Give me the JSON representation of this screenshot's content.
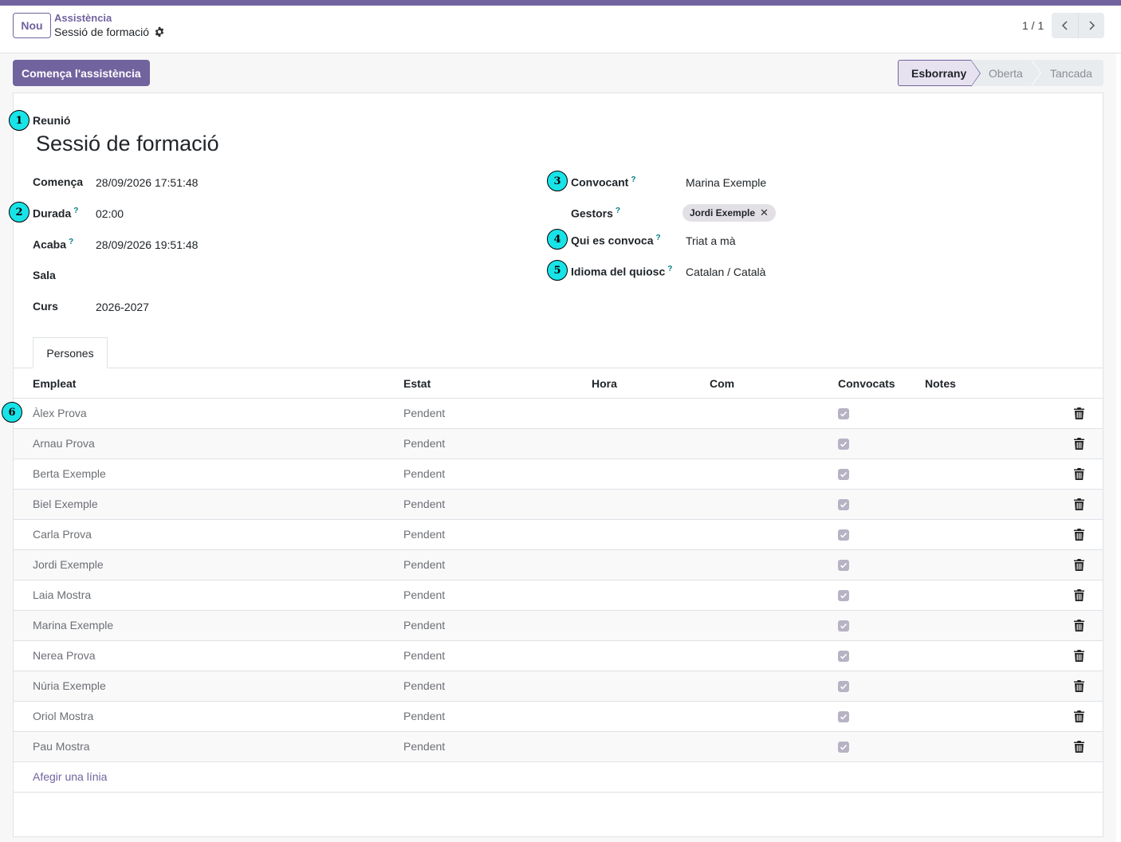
{
  "breadcrumb": {
    "parent": "Assistència",
    "current": "Sessió de formació"
  },
  "new_button": "Nou",
  "pager": {
    "value": "1 / 1"
  },
  "action_button": "Comença l'assistència",
  "statusbar": [
    {
      "label": "Esborrany",
      "active": true
    },
    {
      "label": "Oberta",
      "active": false
    },
    {
      "label": "Tancada",
      "active": false
    }
  ],
  "form": {
    "title_label": "Reunió",
    "title": "Sessió de formació",
    "left": {
      "start_label": "Comença",
      "start_value": "28/09/2026 17:51:48",
      "duration_label": "Durada",
      "duration_value": "02:00",
      "end_label": "Acaba",
      "end_value": "28/09/2026 19:51:48",
      "room_label": "Sala",
      "room_value": "",
      "course_label": "Curs",
      "course_value": "2026-2027"
    },
    "right": {
      "convener_label": "Convocant",
      "convener_value": "Marina Exemple",
      "managers_label": "Gestors",
      "managers_tag": "Jordi Exemple",
      "who_label": "Qui es convoca",
      "who_value": "Triat a mà",
      "lang_label": "Idioma del quiosc",
      "lang_value": "Catalan / Català"
    },
    "help_mark": "?"
  },
  "tab": "Persones",
  "table": {
    "headers": [
      "Empleat",
      "Estat",
      "Hora",
      "Com",
      "Convocats",
      "Notes"
    ],
    "rows": [
      {
        "name": "Àlex Prova",
        "status": "Pendent"
      },
      {
        "name": "Arnau Prova",
        "status": "Pendent"
      },
      {
        "name": "Berta Exemple",
        "status": "Pendent"
      },
      {
        "name": "Biel Exemple",
        "status": "Pendent"
      },
      {
        "name": "Carla Prova",
        "status": "Pendent"
      },
      {
        "name": "Jordi Exemple",
        "status": "Pendent"
      },
      {
        "name": "Laia Mostra",
        "status": "Pendent"
      },
      {
        "name": "Marina Exemple",
        "status": "Pendent"
      },
      {
        "name": "Nerea Prova",
        "status": "Pendent"
      },
      {
        "name": "Núria Exemple",
        "status": "Pendent"
      },
      {
        "name": "Oriol Mostra",
        "status": "Pendent"
      },
      {
        "name": "Pau Mostra",
        "status": "Pendent"
      }
    ],
    "add_line": "Afegir una línia"
  },
  "markers": [
    "1",
    "2",
    "3",
    "4",
    "5",
    "6"
  ],
  "colors": {
    "brand": "#71639e",
    "help": "#017e84",
    "marker": "#18e4e8"
  }
}
